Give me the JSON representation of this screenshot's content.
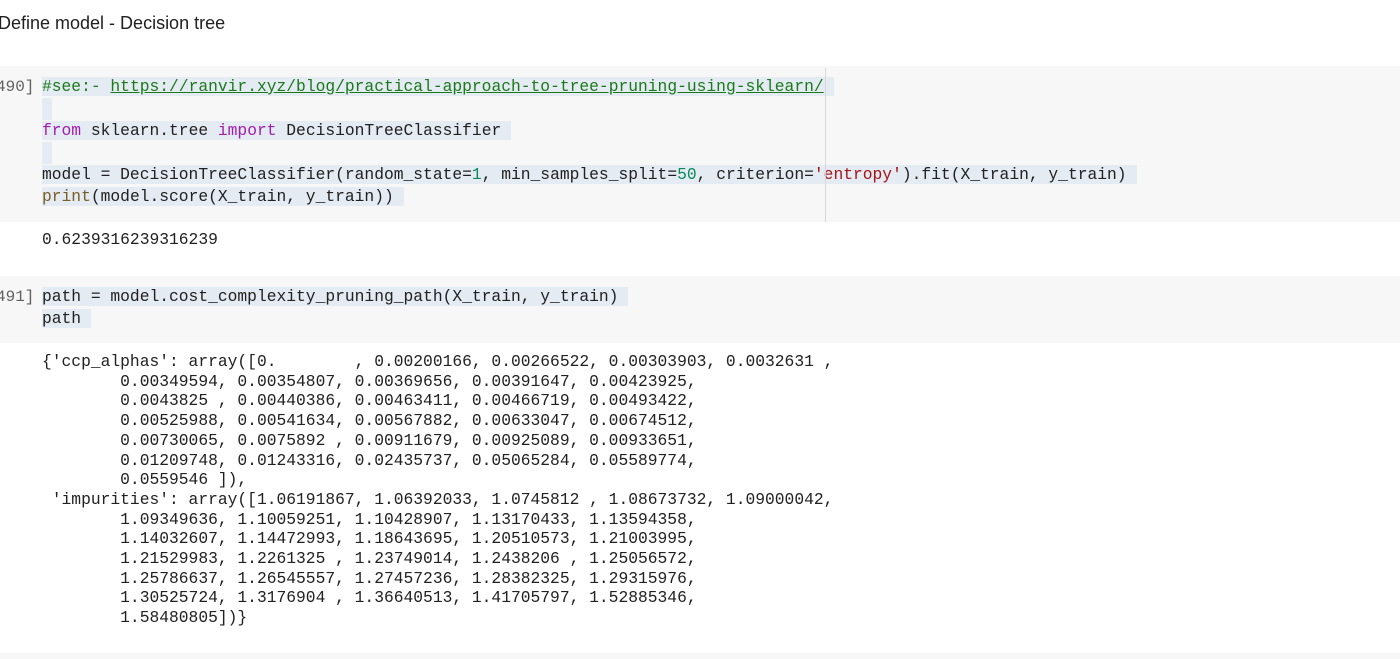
{
  "heading": "Define model - Decision tree",
  "cells": [
    {
      "prompt": "490]",
      "lines": [
        [
          {
            "t": "#see:- ",
            "c": "cmt"
          },
          {
            "t": "https://ranvir.xyz/blog/practical-approach-to-tree-pruning-using-sklearn/",
            "c": "url"
          }
        ],
        [],
        [
          {
            "t": "from",
            "c": "kw"
          },
          {
            "t": " sklearn.tree ",
            "c": ""
          },
          {
            "t": "import",
            "c": "kw"
          },
          {
            "t": " DecisionTreeClassifier",
            "c": ""
          }
        ],
        [],
        [
          {
            "t": "model = DecisionTreeClassifier(random_state=",
            "c": ""
          },
          {
            "t": "1",
            "c": "num"
          },
          {
            "t": ", min_samples_split=",
            "c": ""
          },
          {
            "t": "50",
            "c": "num"
          },
          {
            "t": ", criterion=",
            "c": ""
          },
          {
            "t": "'entropy'",
            "c": "str"
          },
          {
            "t": ").fit(X_train, y_train)",
            "c": ""
          }
        ],
        [
          {
            "t": "print",
            "c": "fn"
          },
          {
            "t": "(model.score(X_train, y_train))",
            "c": ""
          }
        ]
      ],
      "output": [
        "0.6239316239316239"
      ]
    },
    {
      "prompt": "491]",
      "lines": [
        [
          {
            "t": "path = model.cost_complexity_pruning_path(X_train, y_train)",
            "c": ""
          }
        ],
        [
          {
            "t": "path",
            "c": ""
          }
        ]
      ],
      "output": [
        "{'ccp_alphas': array([0.        , 0.00200166, 0.00266522, 0.00303903, 0.0032631 ,",
        "        0.00349594, 0.00354807, 0.00369656, 0.00391647, 0.00423925,",
        "        0.0043825 , 0.00440386, 0.00463411, 0.00466719, 0.00493422,",
        "        0.00525988, 0.00541634, 0.00567882, 0.00633047, 0.00674512,",
        "        0.00730065, 0.0075892 , 0.00911679, 0.00925089, 0.00933651,",
        "        0.01209748, 0.01243316, 0.02435737, 0.05065284, 0.05589774,",
        "        0.0559546 ]),",
        " 'impurities': array([1.06191867, 1.06392033, 1.0745812 , 1.08673732, 1.09000042,",
        "        1.09349636, 1.10059251, 1.10428907, 1.13170433, 1.13594358,",
        "        1.14032607, 1.14472993, 1.18643695, 1.20510573, 1.21003995,",
        "        1.21529983, 1.2261325 , 1.23749014, 1.2438206 , 1.25056572,",
        "        1.25786637, 1.26545557, 1.27457236, 1.28382325, 1.29315976,",
        "        1.30525724, 1.3176904 , 1.36640513, 1.41705797, 1.52885346,",
        "        1.58480805])}"
      ]
    }
  ]
}
